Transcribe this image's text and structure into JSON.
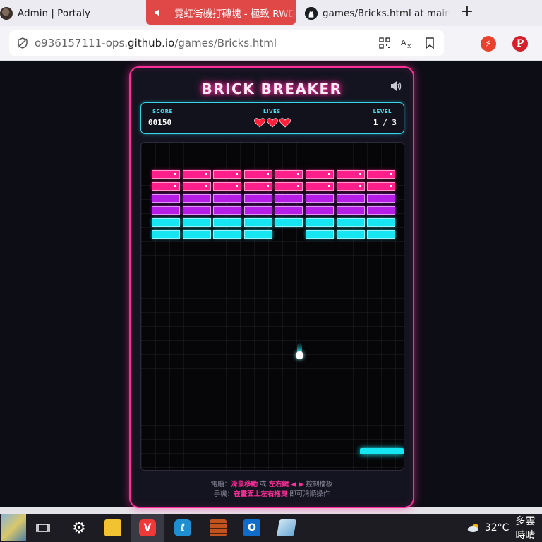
{
  "browser": {
    "tabs": [
      {
        "title": "Admin | Portaly",
        "active": false
      },
      {
        "title": "霓虹街機打磚塊 - 極致 RWD",
        "active": true
      },
      {
        "title": "games/Bricks.html at main ·",
        "active": false
      }
    ],
    "new_tab": "+",
    "url": {
      "prefix": "o936157111-ops.",
      "host": "github.io",
      "path": "/games/Bricks.html"
    },
    "ext_icons": [
      "brave-rewards-icon",
      "pinterest-icon"
    ]
  },
  "game": {
    "title": "BRICK BREAKER",
    "hud": {
      "score_label": "SCORE",
      "score": "00150",
      "lives_label": "LIVES",
      "lives": 3,
      "level_label": "LEVEL",
      "level": "1 / 3"
    },
    "bricks": [
      [
        "pink",
        "pink",
        "pink",
        "pink",
        "pink",
        "pink",
        "pink",
        "pink"
      ],
      [
        "pink",
        "pink",
        "pink",
        "pink",
        "pink",
        "pink",
        "pink",
        "pink"
      ],
      [
        "purple",
        "purple",
        "purple",
        "purple",
        "purple",
        "purple",
        "purple",
        "purple"
      ],
      [
        "purple",
        "purple",
        "purple",
        "purple",
        "purple",
        "purple",
        "purple",
        "purple"
      ],
      [
        "cyan",
        "cyan",
        "cyan",
        "cyan",
        "cyan",
        "cyan",
        "cyan",
        "cyan"
      ],
      [
        "cyan",
        "cyan",
        "cyan",
        "cyan",
        "",
        "cyan",
        "cyan",
        "cyan"
      ]
    ],
    "colors": {
      "pink": "#ff1f8a",
      "purple": "#b61ee8",
      "cyan": "#16e6f2"
    },
    "help": {
      "line1_prefix": "電腦：",
      "line1_hl1": "滑鼠移動",
      "line1_mid": " 或 ",
      "line1_hl2": "左右鍵 ◀ ▶",
      "line1_suffix": " 控制擋板",
      "line2_prefix": "手機：",
      "line2_hl": "在畫面上左右拖曳",
      "line2_suffix": " 即可滑順操作"
    }
  },
  "taskbar": {
    "weather_temp": "32°C",
    "weather_desc": "多雲時晴"
  }
}
